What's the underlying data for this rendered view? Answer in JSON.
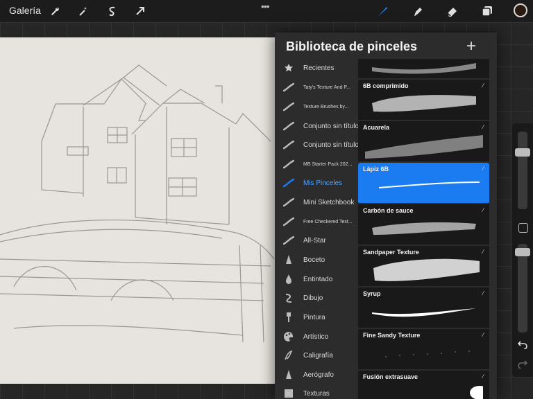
{
  "topbar": {
    "gallery_label": "Galería",
    "tools": [
      "wrench-icon",
      "magic-wand-icon",
      "selection-icon",
      "transform-arrow-icon"
    ],
    "right_tools": [
      "brush-icon",
      "smudge-icon",
      "eraser-icon",
      "layers-icon"
    ],
    "more": "•••",
    "current_color": "#2a1a10",
    "active_tool_color": "#1b7cf2"
  },
  "panel": {
    "title": "Biblioteca de pinceles",
    "add_label": "+",
    "sets": [
      {
        "label": "Recientes",
        "icon": "star-icon"
      },
      {
        "label": "Taty's Texture And P...",
        "icon": "brush-stroke-icon"
      },
      {
        "label": "Texture Brushes by...",
        "icon": "brush-stroke-icon"
      },
      {
        "label": "Conjunto sin título",
        "icon": "brush-stroke-icon"
      },
      {
        "label": "Conjunto sin título",
        "icon": "brush-stroke-icon"
      },
      {
        "label": "MB Starter Pack 202...",
        "icon": "brush-stroke-icon"
      },
      {
        "label": "Mis Pinceles",
        "icon": "brush-stroke-icon"
      },
      {
        "label": "Mini Sketchbook",
        "icon": "brush-stroke-icon"
      },
      {
        "label": "Free Checkered Text...",
        "icon": "brush-stroke-icon"
      },
      {
        "label": "All-Star",
        "icon": "brush-stroke-icon"
      },
      {
        "label": "Boceto",
        "icon": "pencil-tip-icon"
      },
      {
        "label": "Entintado",
        "icon": "ink-drop-icon"
      },
      {
        "label": "Dibujo",
        "icon": "squiggle-icon"
      },
      {
        "label": "Pintura",
        "icon": "paintbrush-icon"
      },
      {
        "label": "Artístico",
        "icon": "palette-icon"
      },
      {
        "label": "Caligrafía",
        "icon": "calligraphy-icon"
      },
      {
        "label": "Aerógrafo",
        "icon": "airbrush-icon"
      },
      {
        "label": "Texturas",
        "icon": "texture-icon"
      }
    ],
    "active_set": "Mis Pinceles",
    "brushes": [
      {
        "name": ""
      },
      {
        "name": "6B comprimido"
      },
      {
        "name": "Acuarela"
      },
      {
        "name": "Lápiz 6B"
      },
      {
        "name": "Carbón de sauce"
      },
      {
        "name": "Sandpaper Texture"
      },
      {
        "name": "Syrup"
      },
      {
        "name": "Fine Sandy Texture"
      },
      {
        "name": "Fusión extrasuave"
      }
    ],
    "selected_brush": "Lápiz 6B"
  }
}
